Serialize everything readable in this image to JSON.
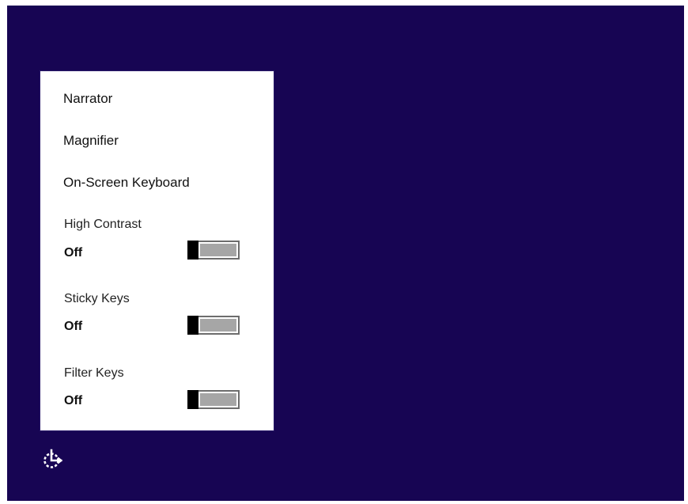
{
  "menu": {
    "narrator": "Narrator",
    "magnifier": "Magnifier",
    "on_screen_keyboard": "On-Screen Keyboard"
  },
  "settings": {
    "high_contrast": {
      "label": "High Contrast",
      "state": "Off"
    },
    "sticky_keys": {
      "label": "Sticky Keys",
      "state": "Off"
    },
    "filter_keys": {
      "label": "Filter Keys",
      "state": "Off"
    }
  },
  "icons": {
    "ease_of_access": "ease-of-access-icon"
  },
  "colors": {
    "background": "#170553",
    "flyout": "#ffffff",
    "toggle_thumb": "#000000",
    "toggle_track_off": "#a6a6a6"
  }
}
